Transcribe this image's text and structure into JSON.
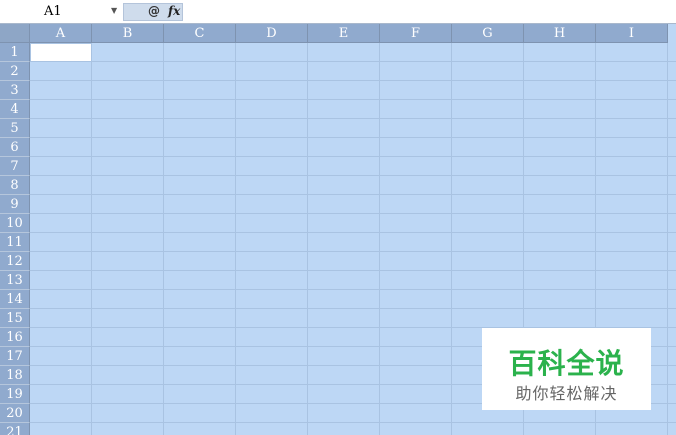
{
  "formula_bar": {
    "name_box": "A1",
    "zoom_icon": "magnifier-icon",
    "fx_label": "fx",
    "formula_value": ""
  },
  "columns": [
    "A",
    "B",
    "C",
    "D",
    "E",
    "F",
    "G",
    "H",
    "I"
  ],
  "rows": [
    "1",
    "2",
    "3",
    "4",
    "5",
    "6",
    "7",
    "8",
    "9",
    "10",
    "11",
    "12",
    "13",
    "14",
    "15",
    "16",
    "17",
    "18",
    "19",
    "20",
    "21"
  ],
  "active_cell": "A1",
  "colors": {
    "sheet_selection": "#bdd7f5",
    "header": "#90aace",
    "watermark_green": "#2bb24c"
  },
  "watermark": {
    "title": "百科全说",
    "subtitle": "助你轻松解决"
  }
}
